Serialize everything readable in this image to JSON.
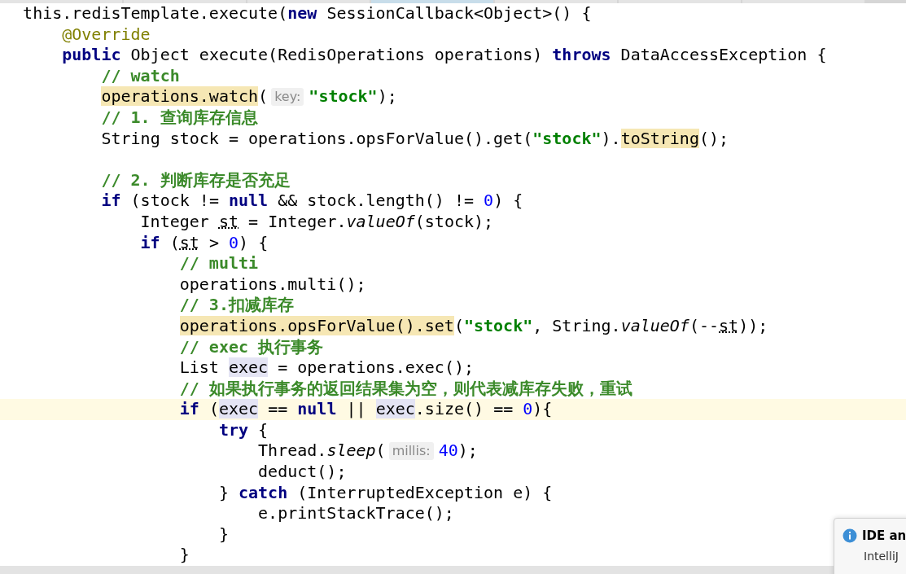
{
  "tabs": [
    {
      "selected": false
    },
    {
      "selected": false
    },
    {
      "selected": false
    },
    {
      "selected": true
    },
    {
      "selected": false
    },
    {
      "selected": false
    },
    {
      "selected": false
    }
  ],
  "lines": [
    {
      "current": false,
      "parts": [
        {
          "kind": "code",
          "tokens": [
            {
              "text": "  this.redisTemplate.execute(",
              "kind": "pl"
            },
            {
              "text": "new",
              "kind": "kw"
            },
            {
              "text": " SessionCallback<Object>() {",
              "kind": "pl"
            }
          ]
        }
      ]
    },
    {
      "current": false,
      "parts": [
        {
          "kind": "code",
          "tokens": [
            {
              "text": "      @Override",
              "kind": "ann"
            }
          ]
        }
      ]
    },
    {
      "current": false,
      "parts": [
        {
          "kind": "code",
          "tokens": [
            {
              "text": "      public",
              "kind": "kw"
            },
            {
              "text": " Object execute(RedisOperations operations) ",
              "kind": "pl"
            },
            {
              "text": "throws",
              "kind": "kw"
            },
            {
              "text": " DataAccessException {",
              "kind": "pl"
            }
          ]
        }
      ]
    },
    {
      "current": false,
      "parts": [
        {
          "kind": "code",
          "tokens": [
            {
              "text": "          // watch",
              "kind": "cm"
            }
          ]
        }
      ]
    },
    {
      "current": false,
      "parts": [
        {
          "kind": "code",
          "tokens": [
            {
              "text": "          operations.watch",
              "kind": "hl"
            },
            {
              "text": "(",
              "kind": "pl"
            }
          ]
        },
        {
          "kind": "hint",
          "text": "key:"
        },
        {
          "kind": "code",
          "tokens": [
            {
              "text": "\"stock\"",
              "kind": "str"
            },
            {
              "text": ");",
              "kind": "pl"
            }
          ]
        }
      ]
    },
    {
      "current": false,
      "parts": [
        {
          "kind": "code",
          "tokens": [
            {
              "text": "          // 1. 查询库存信息",
              "kind": "cm"
            }
          ]
        }
      ]
    },
    {
      "current": false,
      "parts": [
        {
          "kind": "code",
          "tokens": [
            {
              "text": "          String stock = operations.opsForValue().get(",
              "kind": "pl"
            },
            {
              "text": "\"stock\"",
              "kind": "str"
            },
            {
              "text": ").",
              "kind": "pl"
            },
            {
              "text": "toString",
              "kind": "hl"
            },
            {
              "text": "();",
              "kind": "pl"
            }
          ]
        }
      ]
    },
    {
      "current": false
    },
    {
      "current": false,
      "parts": [
        {
          "kind": "code",
          "tokens": [
            {
              "text": "          // 2. 判断库存是否充足",
              "kind": "cm"
            }
          ]
        }
      ]
    },
    {
      "current": false,
      "parts": [
        {
          "kind": "code",
          "tokens": [
            {
              "text": "          if",
              "kind": "kw"
            },
            {
              "text": " (stock != ",
              "kind": "pl"
            },
            {
              "text": "null",
              "kind": "kw"
            },
            {
              "text": " && stock.length() != ",
              "kind": "pl"
            },
            {
              "text": "0",
              "kind": "num"
            },
            {
              "text": ") {",
              "kind": "pl"
            }
          ]
        }
      ]
    },
    {
      "current": false,
      "parts": [
        {
          "kind": "code",
          "tokens": [
            {
              "text": "              Integer ",
              "kind": "pl"
            },
            {
              "text": "st",
              "kind": "var"
            },
            {
              "text": " = Integer.",
              "kind": "pl"
            },
            {
              "text": "valueOf",
              "kind": "it"
            },
            {
              "text": "(stock);",
              "kind": "pl"
            }
          ]
        }
      ]
    },
    {
      "current": false,
      "parts": [
        {
          "kind": "code",
          "tokens": [
            {
              "text": "              if",
              "kind": "kw"
            },
            {
              "text": " (",
              "kind": "pl"
            },
            {
              "text": "st",
              "kind": "var"
            },
            {
              "text": " > ",
              "kind": "pl"
            },
            {
              "text": "0",
              "kind": "num"
            },
            {
              "text": ") {",
              "kind": "pl"
            }
          ]
        }
      ]
    },
    {
      "current": false,
      "parts": [
        {
          "kind": "code",
          "tokens": [
            {
              "text": "                  // multi",
              "kind": "cm"
            }
          ]
        }
      ]
    },
    {
      "current": false,
      "parts": [
        {
          "kind": "code",
          "tokens": [
            {
              "text": "                  operations.multi();",
              "kind": "pl"
            }
          ]
        }
      ]
    },
    {
      "current": false,
      "parts": [
        {
          "kind": "code",
          "tokens": [
            {
              "text": "                  // 3.扣减库存",
              "kind": "cm"
            }
          ]
        }
      ]
    },
    {
      "current": false,
      "parts": [
        {
          "kind": "code",
          "tokens": [
            {
              "text": "                  operations.opsForValue().set",
              "kind": "hl"
            },
            {
              "text": "(",
              "kind": "pl"
            },
            {
              "text": "\"stock\"",
              "kind": "str"
            },
            {
              "text": ", String.",
              "kind": "pl"
            },
            {
              "text": "valueOf",
              "kind": "it"
            },
            {
              "text": "(--",
              "kind": "pl"
            },
            {
              "text": "st",
              "kind": "var"
            },
            {
              "text": "));",
              "kind": "pl"
            }
          ]
        }
      ]
    },
    {
      "current": false,
      "parts": [
        {
          "kind": "code",
          "tokens": [
            {
              "text": "                  // exec 执行事务",
              "kind": "cm"
            }
          ]
        }
      ]
    },
    {
      "current": false,
      "parts": [
        {
          "kind": "code",
          "tokens": [
            {
              "text": "                  List ",
              "kind": "pl"
            },
            {
              "text": "exec",
              "kind": "use"
            },
            {
              "text": " = operations.exec();",
              "kind": "pl"
            }
          ]
        }
      ]
    },
    {
      "current": false,
      "parts": [
        {
          "kind": "code",
          "tokens": [
            {
              "text": "                  // 如果执行事务的返回结果集为空，则代表减库存失败，重试",
              "kind": "cm"
            }
          ]
        }
      ]
    },
    {
      "current": true,
      "parts": [
        {
          "kind": "code",
          "tokens": [
            {
              "text": "                  if",
              "kind": "kw"
            },
            {
              "text": " (",
              "kind": "pl"
            },
            {
              "text": "exec",
              "kind": "use"
            },
            {
              "text": " == ",
              "kind": "pl"
            },
            {
              "text": "null",
              "kind": "kw"
            },
            {
              "text": " || ",
              "kind": "pl"
            },
            {
              "text": "exec",
              "kind": "use"
            },
            {
              "text": ".size() == ",
              "kind": "pl"
            },
            {
              "text": "0",
              "kind": "num"
            },
            {
              "text": "){",
              "kind": "pl"
            }
          ]
        }
      ]
    },
    {
      "current": false,
      "parts": [
        {
          "kind": "code",
          "tokens": [
            {
              "text": "                      try",
              "kind": "kw"
            },
            {
              "text": " {",
              "kind": "pl"
            }
          ]
        }
      ]
    },
    {
      "current": false,
      "parts": [
        {
          "kind": "code",
          "tokens": [
            {
              "text": "                          Thread.",
              "kind": "pl"
            },
            {
              "text": "sleep",
              "kind": "it"
            },
            {
              "text": "(",
              "kind": "pl"
            }
          ]
        },
        {
          "kind": "hint",
          "text": "millis:"
        },
        {
          "kind": "code",
          "tokens": [
            {
              "text": "40",
              "kind": "num"
            },
            {
              "text": ");",
              "kind": "pl"
            }
          ]
        }
      ]
    },
    {
      "current": false,
      "parts": [
        {
          "kind": "code",
          "tokens": [
            {
              "text": "                          deduct();",
              "kind": "pl"
            }
          ]
        }
      ]
    },
    {
      "current": false,
      "parts": [
        {
          "kind": "code",
          "tokens": [
            {
              "text": "                      } ",
              "kind": "pl"
            },
            {
              "text": "catch",
              "kind": "kw"
            },
            {
              "text": " (InterruptedException e) {",
              "kind": "pl"
            }
          ]
        }
      ]
    },
    {
      "current": false,
      "parts": [
        {
          "kind": "code",
          "tokens": [
            {
              "text": "                          e.printStackTrace();",
              "kind": "pl"
            }
          ]
        }
      ]
    },
    {
      "current": false,
      "parts": [
        {
          "kind": "code",
          "tokens": [
            {
              "text": "                      }",
              "kind": "pl"
            }
          ]
        }
      ]
    },
    {
      "current": false,
      "parts": [
        {
          "kind": "code",
          "tokens": [
            {
              "text": "                  }",
              "kind": "pl"
            }
          ]
        }
      ]
    }
  ],
  "notification": {
    "title": "IDE an",
    "body": "IntelliJ"
  }
}
